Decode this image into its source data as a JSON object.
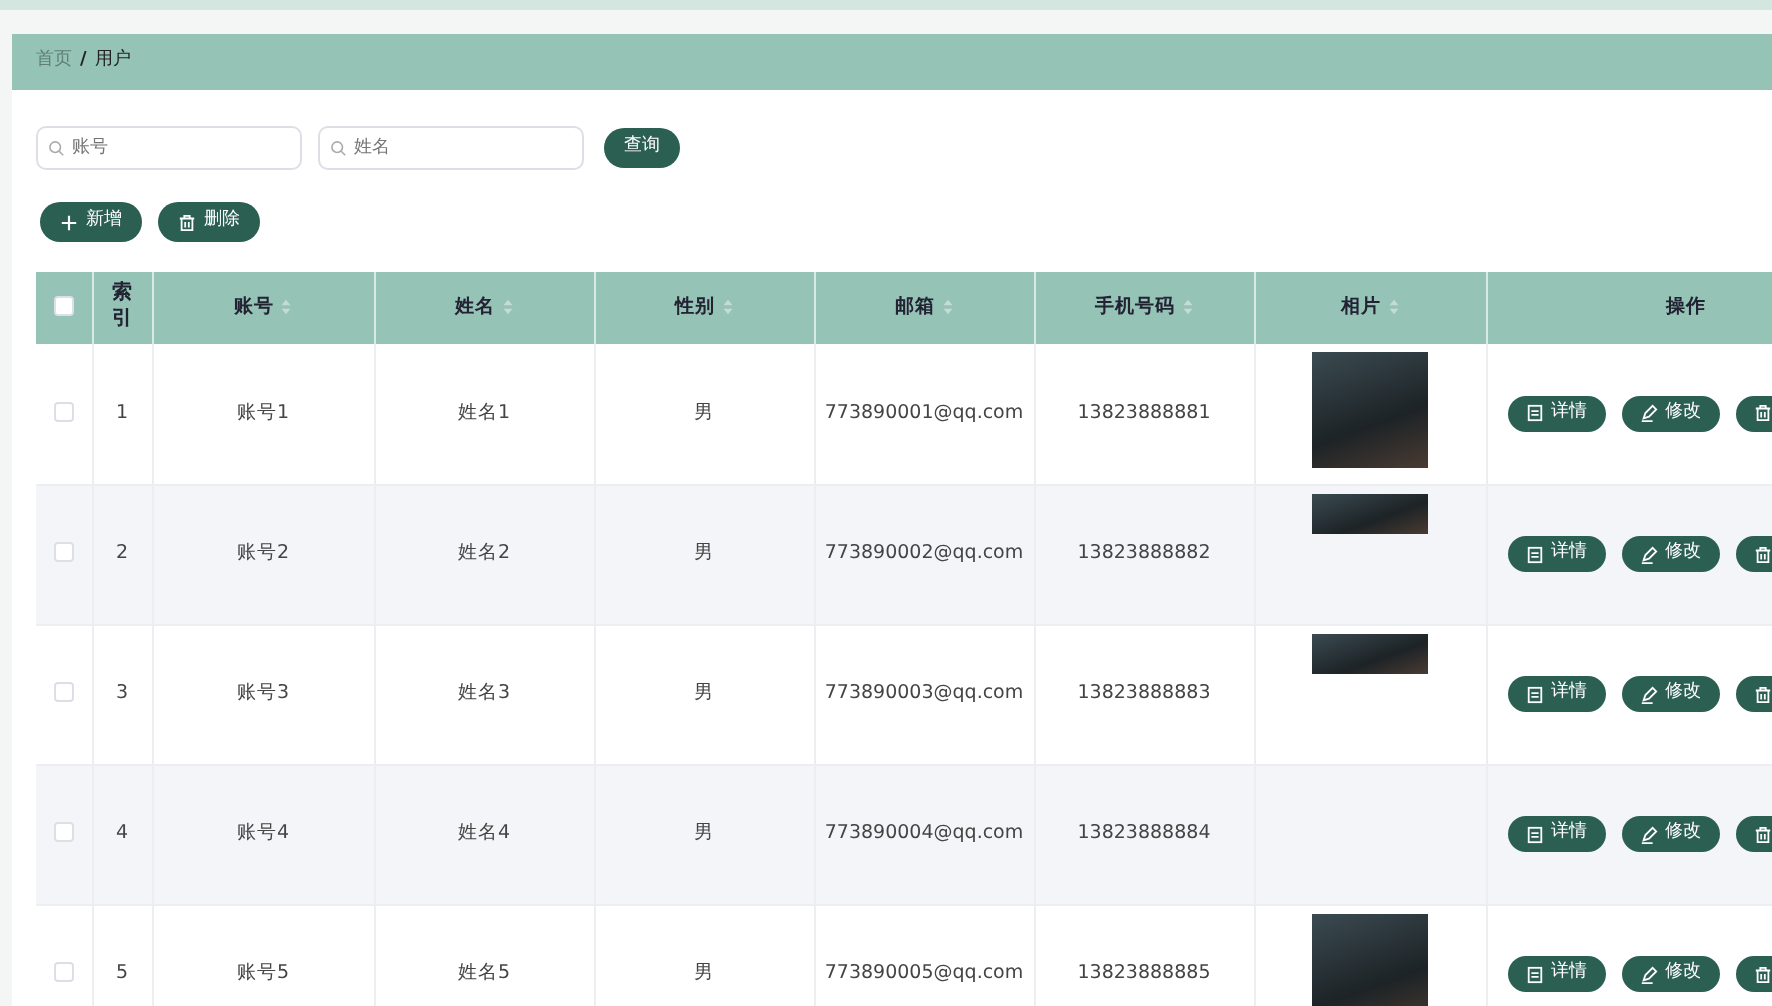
{
  "breadcrumb": [
    {
      "label": "首页",
      "current": false
    },
    {
      "label": "用户",
      "current": true
    }
  ],
  "breadcrumb_separator": "/",
  "search": {
    "fields": [
      {
        "placeholder": "账号"
      },
      {
        "placeholder": "姓名"
      }
    ],
    "button": "查询"
  },
  "toolbar": [
    {
      "kind": "add",
      "label": "新增"
    },
    {
      "kind": "delete",
      "label": "删除"
    }
  ],
  "table": {
    "header_checkbox": {
      "checked": false
    },
    "columns": [
      {
        "label": "索引",
        "sortable": false
      },
      {
        "label": "账号",
        "sortable": true
      },
      {
        "label": "姓名",
        "sortable": true
      },
      {
        "label": "性别",
        "sortable": true
      },
      {
        "label": "邮箱",
        "sortable": true
      },
      {
        "label": "手机号码",
        "sortable": true
      },
      {
        "label": "相片",
        "sortable": true
      },
      {
        "label": "操作",
        "sortable": false
      }
    ],
    "rows": [
      {
        "checked": false,
        "cells": [
          "1",
          "账号1",
          "姓名1",
          "男",
          "773890001@qq.com",
          "13823888881"
        ],
        "has_photo": true,
        "photo_loaded": true,
        "actions": [
          {
            "kind": "detail",
            "label": "详情"
          },
          {
            "kind": "edit",
            "label": "修改"
          },
          {
            "kind": "delete"
          }
        ]
      },
      {
        "checked": false,
        "cells": [
          "2",
          "账号2",
          "姓名2",
          "男",
          "773890002@qq.com",
          "13823888882"
        ],
        "has_photo": true,
        "photo_loaded": false,
        "actions": [
          {
            "kind": "detail",
            "label": "详情"
          },
          {
            "kind": "edit",
            "label": "修改"
          },
          {
            "kind": "delete"
          }
        ]
      },
      {
        "checked": false,
        "cells": [
          "3",
          "账号3",
          "姓名3",
          "男",
          "773890003@qq.com",
          "13823888883"
        ],
        "has_photo": true,
        "photo_loaded": false,
        "actions": [
          {
            "kind": "detail",
            "label": "详情"
          },
          {
            "kind": "edit",
            "label": "修改"
          },
          {
            "kind": "delete"
          }
        ]
      },
      {
        "checked": false,
        "cells": [
          "4",
          "账号4",
          "姓名4",
          "男",
          "773890004@qq.com",
          "13823888884"
        ],
        "has_photo": false,
        "actions": [
          {
            "kind": "detail",
            "label": "详情"
          },
          {
            "kind": "edit",
            "label": "修改"
          },
          {
            "kind": "delete"
          }
        ]
      },
      {
        "checked": false,
        "cells": [
          "5",
          "账号5",
          "姓名5",
          "男",
          "773890005@qq.com",
          "13823888885"
        ],
        "has_photo": true,
        "photo_loaded": true,
        "actions": [
          {
            "kind": "detail",
            "label": "详情"
          },
          {
            "kind": "edit",
            "label": "修改"
          },
          {
            "kind": "delete"
          }
        ]
      }
    ]
  }
}
